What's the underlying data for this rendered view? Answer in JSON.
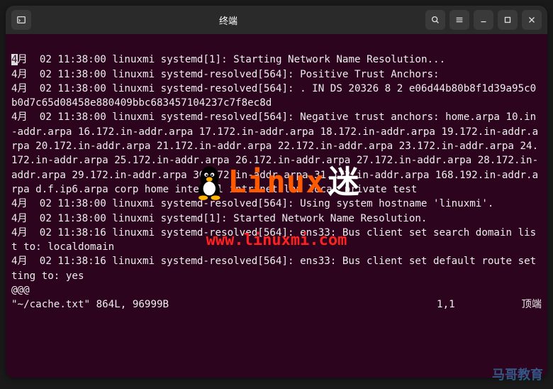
{
  "titlebar": {
    "title": "终端"
  },
  "terminal": {
    "cursor_char": "4",
    "lines": [
      "月  02 11:38:00 linuxmi systemd[1]: Starting Network Name Resolution...",
      "4月  02 11:38:00 linuxmi systemd-resolved[564]: Positive Trust Anchors:",
      "4月  02 11:38:00 linuxmi systemd-resolved[564]: . IN DS 20326 8 2 e06d44b80b8f1d39a95c0b0d7c65d08458e880409bbc683457104237c7f8ec8d",
      "4月  02 11:38:00 linuxmi systemd-resolved[564]: Negative trust anchors: home.arpa 10.in-addr.arpa 16.172.in-addr.arpa 17.172.in-addr.arpa 18.172.in-addr.arpa 19.172.in-addr.arpa 20.172.in-addr.arpa 21.172.in-addr.arpa 22.172.in-addr.arpa 23.172.in-addr.arpa 24.172.in-addr.arpa 25.172.in-addr.arpa 26.172.in-addr.arpa 27.172.in-addr.arpa 28.172.in-addr.arpa 29.172.in-addr.arpa 30.172.in-addr.arpa 31.172.in-addr.arpa 168.192.in-addr.arpa d.f.ip6.arpa corp home internal intranet lan local private test",
      "4月  02 11:38:00 linuxmi systemd-resolved[564]: Using system hostname 'linuxmi'.",
      "4月  02 11:38:00 linuxmi systemd[1]: Started Network Name Resolution.",
      "4月  02 11:38:16 linuxmi systemd-resolved[564]: ens33: Bus client set search domain list to: localdomain",
      "4月  02 11:38:16 linuxmi systemd-resolved[564]: ens33: Bus client set default route setting to: yes",
      "@@@"
    ],
    "status_left": "\"~/cache.txt\" 864L, 96999B",
    "status_right": "1,1           顶端"
  },
  "watermark": {
    "brand": "Linux",
    "brand_cn": "迷",
    "url": "www.linuxmi.com"
  },
  "bottom_watermark": "马哥教育"
}
